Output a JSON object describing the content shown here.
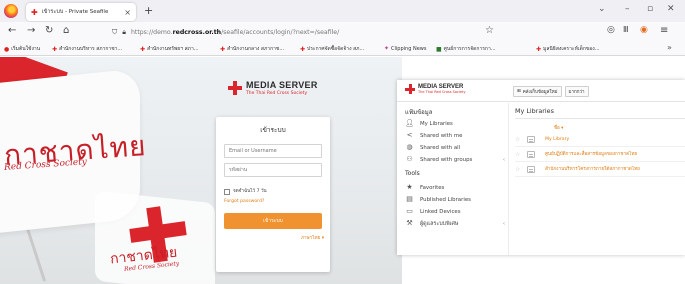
{
  "browser": {
    "tab_title": "เข้าระบบ - Private Seafile",
    "url_prefix": "https://demo.",
    "url_host": "redcross.or.th",
    "url_path": "/seafile/accounts/login/?next=/seafile/",
    "bookmarks": [
      "เริ่มต้นใช้งาน",
      "สำนักงานบริหาร สภากาชา...",
      "สำนักงานทรัพยฯ สภา...",
      "สำนักงานกลาง สภากาช...",
      "ประกาศจัดซื้อจัดจ้าง สภ...",
      "Clipping News",
      "ศูนย์การการจัดการกา...",
      "มูลนิธิสงเคราะห์เด็กของ..."
    ]
  },
  "login": {
    "brand_title": "MEDIA SERVER",
    "brand_sub": "The Thai Red Cross Society",
    "flag_text": "กาชาดไทย",
    "flag_sub": "Red Cross Society",
    "flag2_text": "กาชาดไทย",
    "flag2_sub": "Red Cross Society",
    "heading": "เข้าระบบ",
    "email_placeholder": "Email or Username",
    "password_placeholder": "รหัสผ่าน",
    "remember_label": "จดจำฉันไว้ 7 วัน",
    "forgot_label": "Forgot password?",
    "submit_label": "เข้าระบบ",
    "language_label": "ภาษาไทย ▾"
  },
  "library": {
    "brand_title": "MEDIA SERVER",
    "brand_sub": "The Thai Red Cross Society",
    "toolbar": {
      "new_library": "คลังเก็บข้อมูลใหม่",
      "more": "มากกว่า"
    },
    "sidebar": {
      "files_heading": "แฟ้มข้อมูล",
      "tools_heading": "Tools",
      "files_items": [
        {
          "label": "My Libraries",
          "icon": "user-icon"
        },
        {
          "label": "Shared with me",
          "icon": "share-icon"
        },
        {
          "label": "Shared with all",
          "icon": "globe-icon"
        },
        {
          "label": "Shared with groups",
          "icon": "group-icon"
        }
      ],
      "tools_items": [
        {
          "label": "Favorites",
          "icon": "star-icon"
        },
        {
          "label": "Published Libraries",
          "icon": "book-icon"
        },
        {
          "label": "Linked Devices",
          "icon": "monitor-icon"
        },
        {
          "label": "ผู้ดูแลระบบพิเศษ",
          "icon": "wrench-icon"
        }
      ]
    },
    "main": {
      "title": "My Libraries",
      "name_column": "ชื่อ ▾",
      "rows": [
        {
          "name": "My Library"
        },
        {
          "name": "ศูนย์ปฏิบัติการและสื่อสารข้อมูลของกาชาดไทย"
        },
        {
          "name": "สำนักงานบริหารโครงการภายใต้สภากาชาดไทย"
        }
      ]
    }
  },
  "colors": {
    "brand_red": "#d9252b",
    "accent_orange": "#f0922f",
    "link_orange": "#e07c14"
  }
}
